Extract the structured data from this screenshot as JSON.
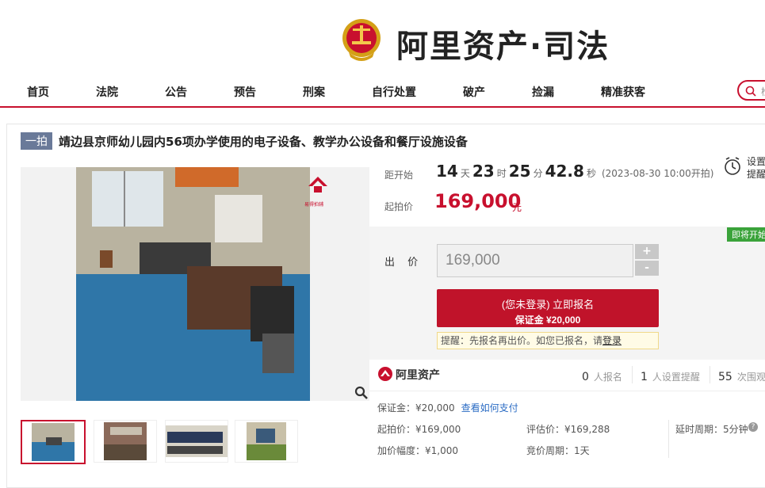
{
  "brand": {
    "name": "阿里资产·司法"
  },
  "nav": {
    "items": [
      "首页",
      "法院",
      "公告",
      "预告",
      "刑案",
      "自行处置",
      "破产",
      "捡漏",
      "精准获客"
    ]
  },
  "search": {
    "placeholder": "检"
  },
  "item": {
    "tag": "一拍",
    "title": "靖边县京师幼儿园内56项办学使用的电子设备、教学办公设备和餐厅设施设备",
    "watermark": "易得拍辅"
  },
  "countdown": {
    "label": "距开始",
    "days": "14",
    "days_unit": "天",
    "hours": "23",
    "hours_unit": "时",
    "minutes": "25",
    "minutes_unit": "分",
    "seconds": "42.8",
    "seconds_unit": "秒",
    "start_time": "(2023-08-30 10:00开拍)"
  },
  "start_price": {
    "label": "起拍价",
    "value": "169,000",
    "unit": "元"
  },
  "reminder": {
    "line1": "设置",
    "line2": "提醒",
    "icon": "alarm-clock-icon"
  },
  "badge": "即将开始",
  "bid": {
    "label": "出 价",
    "value": "169,000",
    "plus": "+",
    "minus": "-",
    "signup_line1": "(您未登录) 立即报名",
    "signup_line2": "保证金 ¥20,000",
    "tip_prefix": "提醒：先报名再出价。如您已报名，请",
    "tip_link": "登录"
  },
  "ali": {
    "name": "阿里资产"
  },
  "stats": [
    {
      "num": "0",
      "text": "人报名"
    },
    {
      "num": "1",
      "text": "人设置提醒"
    },
    {
      "num": "55",
      "text": "次围观"
    }
  ],
  "details": {
    "deposit": "保证金：¥20,000",
    "deposit_link": "查看如何支付",
    "start_price": "起拍价：¥169,000",
    "appraisal": "评估价：¥169,288",
    "delay": "延时周期：5分钟",
    "increment": "加价幅度：¥1,000",
    "cycle": "竞价周期：1天"
  },
  "colors": {
    "accent": "#c8102e",
    "badge": "#3aa33a",
    "link": "#2b6cc4"
  }
}
